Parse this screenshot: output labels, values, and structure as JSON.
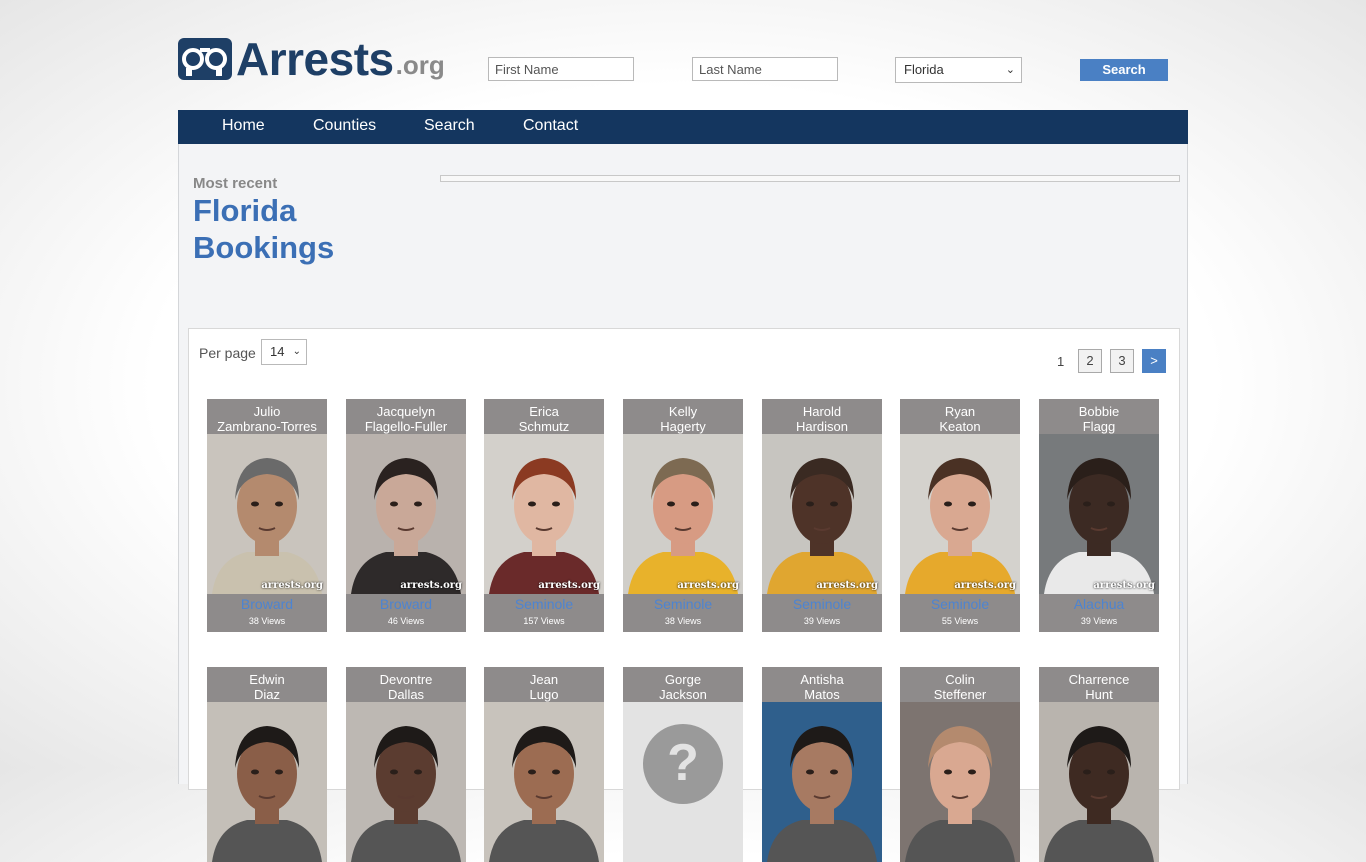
{
  "header": {
    "logo_main": "Arrests",
    "logo_ext": ".org",
    "first_name_placeholder": "First Name",
    "last_name_placeholder": "Last Name",
    "state_selected": "Florida",
    "search_label": "Search"
  },
  "nav": {
    "items": [
      "Home",
      "Counties",
      "Search",
      "Contact"
    ]
  },
  "heading": {
    "kicker": "Most recent",
    "title_line1": "Florida",
    "title_line2": "Bookings"
  },
  "listing": {
    "per_page_label": "Per page",
    "per_page_value": "14",
    "pagination": {
      "current": "1",
      "pages": [
        "2",
        "3"
      ],
      "next": ">"
    },
    "row1": [
      {
        "first": "Julio",
        "last": "Zambrano-Torres",
        "county": "Broward",
        "views": "38 Views",
        "bg": "#c9c4bd",
        "skin": "#b48a6e",
        "hair": "#6a6a6a",
        "shirt": "#c9c1ae"
      },
      {
        "first": "Jacquelyn",
        "last": "Flagello-Fuller",
        "county": "Broward",
        "views": "46 Views",
        "bg": "#b9b2ad",
        "skin": "#c9a898",
        "hair": "#2a2220",
        "shirt": "#2e2a2a"
      },
      {
        "first": "Erica",
        "last": "Schmutz",
        "county": "Seminole",
        "views": "157 Views",
        "bg": "#d3d0cb",
        "skin": "#e0b7a2",
        "hair": "#8b3a22",
        "shirt": "#6a2a2a"
      },
      {
        "first": "Kelly",
        "last": "Hagerty",
        "county": "Seminole",
        "views": "38 Views",
        "bg": "#d0cec9",
        "skin": "#d79b83",
        "hair": "#7d6a52",
        "shirt": "#e8b22b"
      },
      {
        "first": "Harold",
        "last": "Hardison",
        "county": "Seminole",
        "views": "39 Views",
        "bg": "#c7c5c0",
        "skin": "#4e3328",
        "hair": "#3a2a22",
        "shirt": "#e0a630"
      },
      {
        "first": "Ryan",
        "last": "Keaton",
        "county": "Seminole",
        "views": "55 Views",
        "bg": "#d4d2cd",
        "skin": "#d9a891",
        "hair": "#4a3124",
        "shirt": "#e6a92c"
      },
      {
        "first": "Bobbie",
        "last": "Flagg",
        "county": "Alachua",
        "views": "39 Views",
        "bg": "#777a7c",
        "skin": "#3c2a23",
        "hair": "#2a1f1a",
        "shirt": "#e9e9e9"
      }
    ],
    "row2": [
      {
        "first": "Edwin",
        "last": "Diaz",
        "bg": "#c4bfb8",
        "skin": "#8a5e48",
        "hair": "#1e1a18"
      },
      {
        "first": "Devontre",
        "last": "Dallas",
        "bg": "#bdb8b3",
        "skin": "#5b3c30",
        "hair": "#1e1a18"
      },
      {
        "first": "Jean",
        "last": "Lugo",
        "bg": "#c8c3bc",
        "skin": "#9c6c52",
        "hair": "#1e1a18"
      },
      {
        "first": "Gorge",
        "last": "Jackson",
        "bg": "#e3e3e3",
        "skin": "#9a9a9a",
        "hair": "#9a9a9a"
      },
      {
        "first": "Antisha",
        "last": "Matos",
        "bg": "#2f5f8c",
        "skin": "#a77a62",
        "hair": "#1e1a18"
      },
      {
        "first": "Colin",
        "last": "Steffener",
        "bg": "#7d7470",
        "skin": "#d9a891",
        "hair": "#b48a6e"
      },
      {
        "first": "Charrence",
        "last": "Hunt",
        "bg": "#b9b4ae",
        "skin": "#3e2a22",
        "hair": "#1e1a18"
      }
    ],
    "watermark": "arrests.org"
  }
}
